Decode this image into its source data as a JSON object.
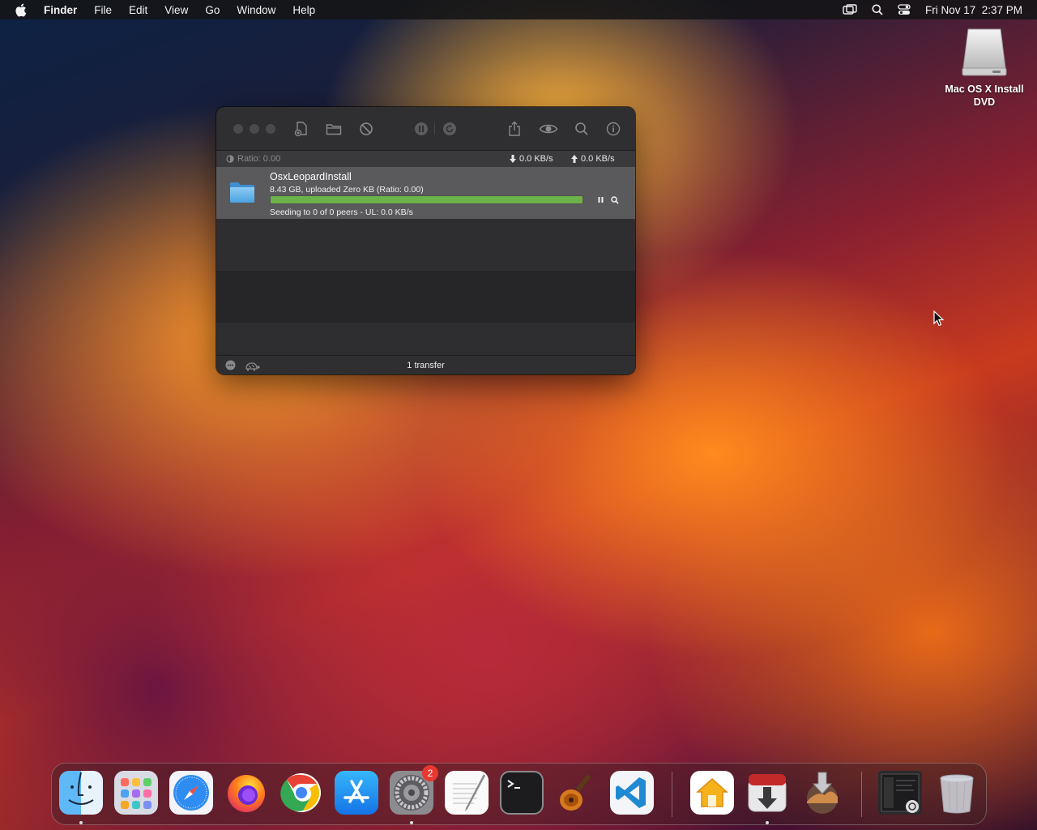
{
  "menubar": {
    "app_name": "Finder",
    "items": [
      "File",
      "Edit",
      "View",
      "Go",
      "Window",
      "Help"
    ],
    "clock": "Fri Nov 17  2:37 PM",
    "icons": [
      "screen-mirroring-icon",
      "spotlight-search-icon",
      "control-center-icon"
    ]
  },
  "desktop": {
    "icon_label": "Mac OS X Install DVD"
  },
  "window": {
    "toolbar_icons": [
      "create-torrent-icon",
      "open-folder-icon",
      "remove-icon",
      "pause-all-icon",
      "resume-all-icon",
      "share-icon",
      "quicklook-icon",
      "search-icon",
      "info-icon"
    ],
    "status": {
      "ratio": "Ratio: 0.00",
      "download_speed": "0.0 KB/s",
      "upload_speed": "0.0 KB/s"
    },
    "transfers": [
      {
        "name": "OsxLeopardInstall",
        "info": "8.43 GB, uploaded Zero KB (Ratio: 0.00)",
        "progress": 1.0,
        "status": "Seeding to 0 of 0 peers - UL: 0.0 KB/s"
      }
    ],
    "footer": {
      "count": "1 transfer"
    }
  },
  "dock": {
    "apps": [
      {
        "name": "Finder",
        "running": true
      },
      {
        "name": "Launchpad",
        "running": false
      },
      {
        "name": "Safari",
        "running": false
      },
      {
        "name": "Firefox",
        "running": false
      },
      {
        "name": "Chrome",
        "running": false
      },
      {
        "name": "App Store",
        "running": false
      },
      {
        "name": "System Preferences",
        "running": true,
        "badge": "2"
      },
      {
        "name": "TextEdit",
        "running": false
      },
      {
        "name": "Terminal",
        "running": false
      },
      {
        "name": "GarageBand",
        "running": false
      },
      {
        "name": "Visual Studio Code",
        "running": false
      },
      {
        "name": "Home",
        "running": false
      },
      {
        "name": "Transmission",
        "running": true
      },
      {
        "name": "Install macOS",
        "running": false
      },
      {
        "name": "Downloads",
        "running": false
      },
      {
        "name": "Trash",
        "running": false
      }
    ]
  }
}
